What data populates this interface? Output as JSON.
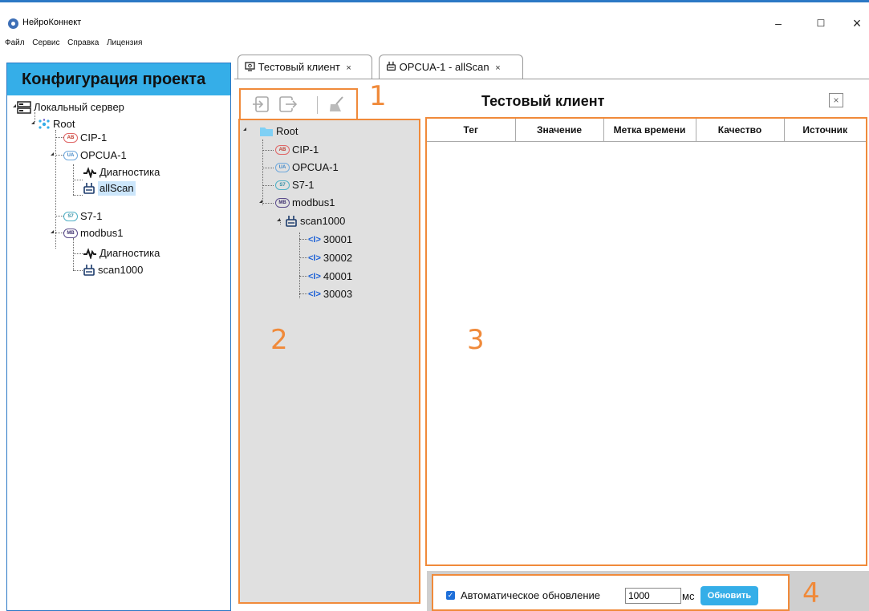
{
  "window": {
    "title": "НейроКоннект",
    "controls": {
      "minimize": "–",
      "maximize": "☐",
      "close": "×"
    }
  },
  "menu": [
    "Файл",
    "Сервис",
    "Справка",
    "Лицензия"
  ],
  "left_panel": {
    "header": "Конфигурация проекта",
    "tree": {
      "server": "Локальный сервер",
      "root": "Root",
      "cip": "CIP-1",
      "opcua": "OPCUA-1",
      "opcua_diag": "Диагностика",
      "allscan": "allScan",
      "s7": "S7-1",
      "modbus": "modbus1",
      "modbus_diag": "Диагностика",
      "scan1000": "scan1000"
    }
  },
  "tabs": [
    {
      "label": "Тестовый клиент",
      "close": "×",
      "icon": "monitor-icon"
    },
    {
      "label": "OPCUA-1 - allScan",
      "close": "×",
      "icon": "scan-group-icon"
    }
  ],
  "toolbar": {
    "icons": [
      "import-icon",
      "export-icon",
      "clear-broom-icon"
    ]
  },
  "annotations": {
    "n1": "1",
    "n2": "2",
    "n3": "3",
    "n4": "4"
  },
  "browse_tree": {
    "root": "Root",
    "cip": "CIP-1",
    "opcua": "OPCUA-1",
    "s7": "S7-1",
    "modbus": "modbus1",
    "scan1000": "scan1000",
    "tags": [
      "30001",
      "30002",
      "40001",
      "30003"
    ]
  },
  "main": {
    "title": "Тестовый клиент",
    "close": "×",
    "columns": [
      "Тег",
      "Значение",
      "Метка времени",
      "Качество",
      "Источник"
    ]
  },
  "refresh": {
    "auto_label": "Автоматическое обновление",
    "checked": true,
    "interval": "1000",
    "unit": "мс",
    "button": "Обновить"
  },
  "colors": {
    "accent": "#35aee8",
    "highlight": "#f08a3a",
    "selection": "#cce6fb",
    "window_border": "#2b78c5"
  }
}
